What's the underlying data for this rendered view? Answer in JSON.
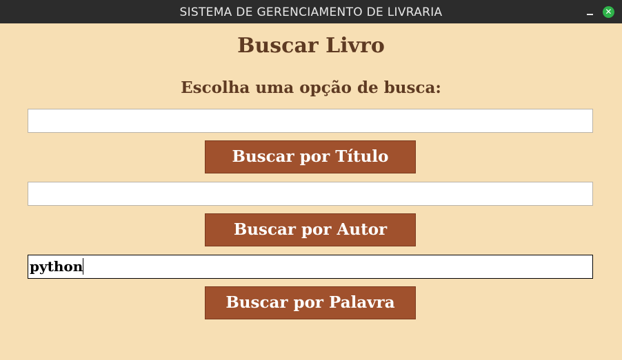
{
  "window": {
    "title": "SISTEMA DE GERENCIAMENTO DE LIVRARIA",
    "minimize_icon": "minimize-icon",
    "close_icon": "close-icon",
    "close_glyph": "✕",
    "close_color": "#2fb34a"
  },
  "page": {
    "heading": "Buscar Livro",
    "subheading": "Escolha uma opção de busca:"
  },
  "search": {
    "title_field_value": "",
    "title_button": "Buscar por Título",
    "author_field_value": "",
    "author_button": "Buscar por Autor",
    "keyword_field_value": "python",
    "keyword_button": "Buscar por Palavra"
  },
  "colors": {
    "background": "#f7dfb4",
    "heading_text": "#5e3a22",
    "button_bg": "#a0512d",
    "button_text": "#ffffff",
    "titlebar": "#2c2c2c"
  }
}
